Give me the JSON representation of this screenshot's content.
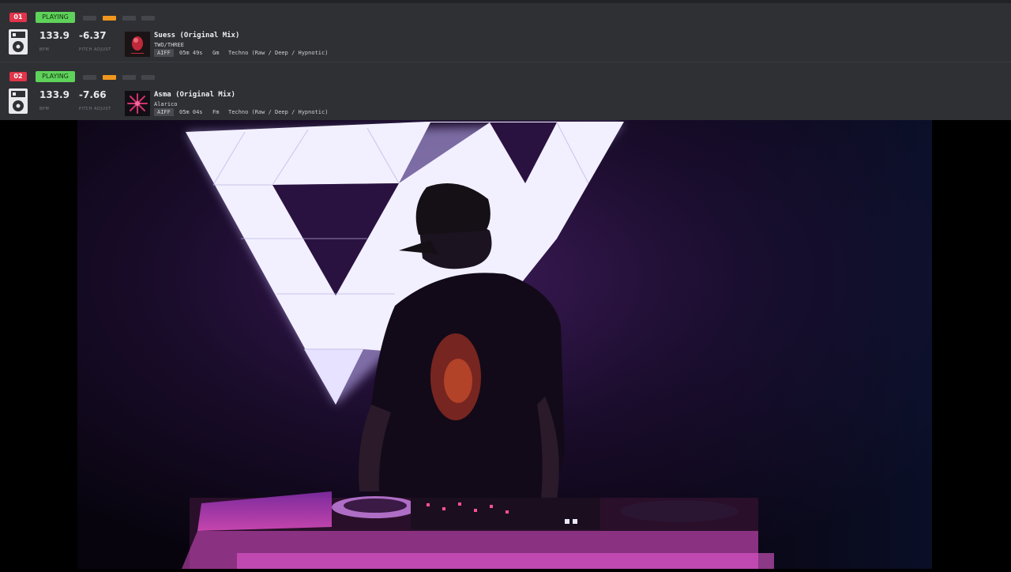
{
  "decks": [
    {
      "number": "01",
      "status": "PLAYING",
      "beat_active": 2,
      "bpm": "133.9",
      "bpm_label": "BPM",
      "pitch": "-6.37",
      "pitch_label": "PITCH ADJUST",
      "title": "Suess (Original Mix)",
      "artist": "TWO/THREE",
      "format": "AIFF",
      "duration": "05m 49s",
      "key": "Gm",
      "genre": "Techno (Raw / Deep / Hypnotic)",
      "art_color": "#c0293b"
    },
    {
      "number": "02",
      "status": "PLAYING",
      "beat_active": 2,
      "bpm": "133.9",
      "bpm_label": "BPM",
      "pitch": "-7.66",
      "pitch_label": "PITCH ADJUST",
      "title": "Asma (Original Mix)",
      "artist": "Alarico",
      "format": "AIFF",
      "duration": "05m 04s",
      "key": "Fm",
      "genre": "Techno (Raw / Deep / Hypnotic)",
      "art_color": "#d6306f"
    }
  ],
  "colors": {
    "panel_bg": "#2f3034",
    "deck_badge": "#e2344a",
    "playing": "#5ed25a",
    "beat_active": "#f0961e",
    "beat_inactive": "#45464b",
    "stage_light": "#f2f0ff",
    "stage_purple": "#5a1f7a",
    "controller_pink": "#d94fc9"
  }
}
